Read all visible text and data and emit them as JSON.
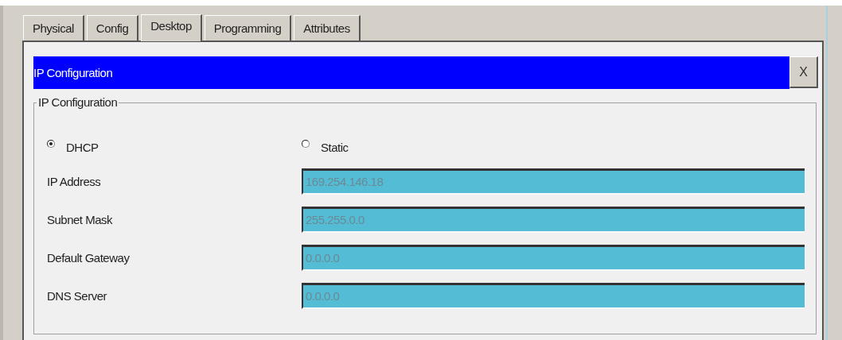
{
  "tabs": [
    {
      "label": "Physical",
      "selected": false
    },
    {
      "label": "Config",
      "selected": false
    },
    {
      "label": "Desktop",
      "selected": true
    },
    {
      "label": "Programming",
      "selected": false
    },
    {
      "label": "Attributes",
      "selected": false
    }
  ],
  "dialog": {
    "title": "IP Configuration",
    "close": "X"
  },
  "group": {
    "legend": "IP Configuration",
    "modes": [
      {
        "label": "DHCP",
        "selected": true
      },
      {
        "label": "Static",
        "selected": false
      }
    ],
    "fields": [
      {
        "label": "IP Address",
        "value": "169.254.146.18",
        "disabled": true
      },
      {
        "label": "Subnet Mask",
        "value": "255.255.0.0",
        "disabled": true
      },
      {
        "label": "Default Gateway",
        "value": "0.0.0.0",
        "disabled": true
      },
      {
        "label": "DNS Server",
        "value": "0.0.0.0",
        "disabled": true
      }
    ]
  }
}
